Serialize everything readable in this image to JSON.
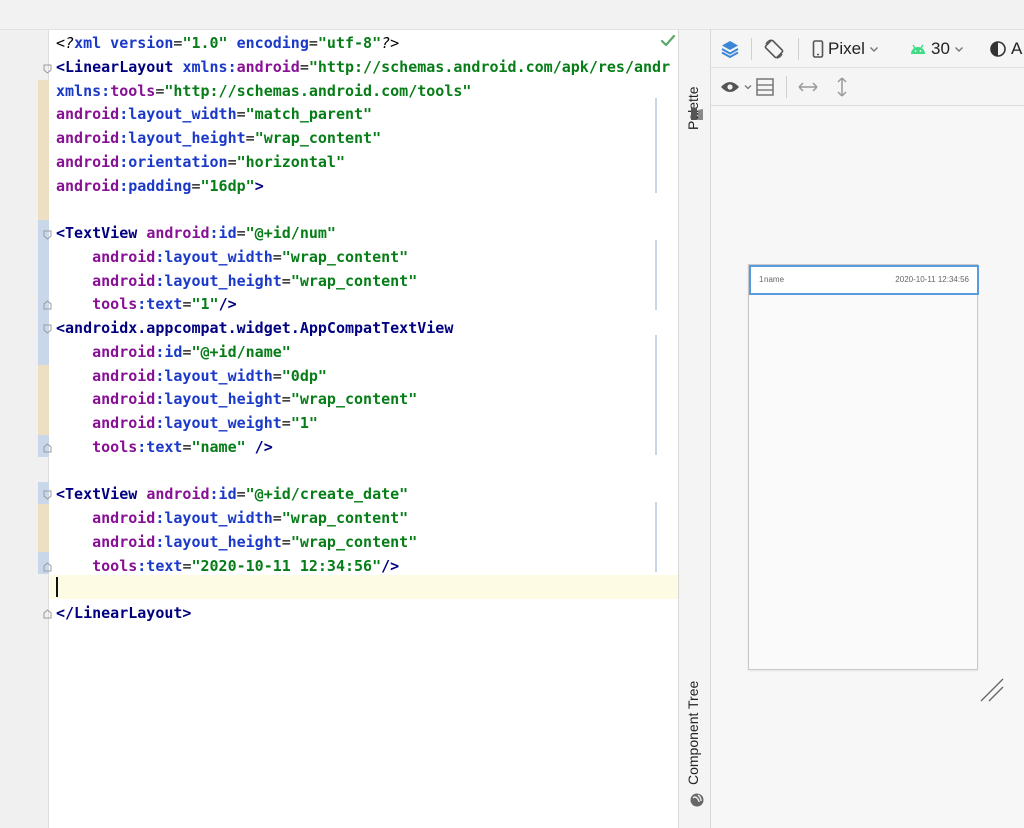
{
  "editor": {
    "lines": [
      [
        [
          "pi",
          "<?"
        ],
        [
          "pa",
          "xml version"
        ],
        [
          "pi",
          "="
        ],
        [
          "str",
          "\"1.0\""
        ],
        [
          "pa",
          " encoding"
        ],
        [
          "pi",
          "="
        ],
        [
          "str",
          "\"utf-8\""
        ],
        [
          "pi",
          "?>"
        ]
      ],
      [
        [
          "tag",
          "<LinearLayout "
        ],
        [
          "ns",
          "xmlns:"
        ],
        [
          "pur",
          "android"
        ],
        [
          "pi",
          "="
        ],
        [
          "str",
          "\"http://schemas.android.com/apk/res/andr"
        ]
      ],
      [
        [
          "ns",
          "xmlns:"
        ],
        [
          "pur",
          "tools"
        ],
        [
          "pi",
          "="
        ],
        [
          "str",
          "\"http://schemas.android.com/tools\""
        ]
      ],
      [
        [
          "pur",
          "android"
        ],
        [
          "ns",
          ":layout_width"
        ],
        [
          "pi",
          "="
        ],
        [
          "str",
          "\"match_parent\""
        ]
      ],
      [
        [
          "pur",
          "android"
        ],
        [
          "ns",
          ":layout_height"
        ],
        [
          "pi",
          "="
        ],
        [
          "str",
          "\"wrap_content\""
        ]
      ],
      [
        [
          "pur",
          "android"
        ],
        [
          "ns",
          ":orientation"
        ],
        [
          "pi",
          "="
        ],
        [
          "str",
          "\"horizontal\""
        ]
      ],
      [
        [
          "pur",
          "android"
        ],
        [
          "ns",
          ":padding"
        ],
        [
          "pi",
          "="
        ],
        [
          "str",
          "\"16dp\""
        ],
        [
          "tag",
          ">"
        ]
      ],
      [],
      [
        [
          "tag",
          "<TextView "
        ],
        [
          "pur",
          "android"
        ],
        [
          "ns",
          ":id"
        ],
        [
          "pi",
          "="
        ],
        [
          "str",
          "\"@+id/num\""
        ]
      ],
      [
        [
          "pi",
          "    "
        ],
        [
          "pur",
          "android"
        ],
        [
          "ns",
          ":layout_width"
        ],
        [
          "pi",
          "="
        ],
        [
          "str",
          "\"wrap_content\""
        ]
      ],
      [
        [
          "pi",
          "    "
        ],
        [
          "pur",
          "android"
        ],
        [
          "ns",
          ":layout_height"
        ],
        [
          "pi",
          "="
        ],
        [
          "str",
          "\"wrap_content\""
        ]
      ],
      [
        [
          "pi",
          "    "
        ],
        [
          "pur",
          "tools"
        ],
        [
          "ns",
          ":text"
        ],
        [
          "pi",
          "="
        ],
        [
          "str",
          "\"1\""
        ],
        [
          "tag",
          "/>"
        ]
      ],
      [
        [
          "tag",
          "<androidx.appcompat.widget.AppCompatTextView"
        ]
      ],
      [
        [
          "pi",
          "    "
        ],
        [
          "pur",
          "android"
        ],
        [
          "ns",
          ":id"
        ],
        [
          "pi",
          "="
        ],
        [
          "str",
          "\"@+id/name\""
        ]
      ],
      [
        [
          "pi",
          "    "
        ],
        [
          "pur",
          "android"
        ],
        [
          "ns",
          ":layout_width"
        ],
        [
          "pi",
          "="
        ],
        [
          "str",
          "\"0dp\""
        ]
      ],
      [
        [
          "pi",
          "    "
        ],
        [
          "pur",
          "android"
        ],
        [
          "ns",
          ":layout_height"
        ],
        [
          "pi",
          "="
        ],
        [
          "str",
          "\"wrap_content\""
        ]
      ],
      [
        [
          "pi",
          "    "
        ],
        [
          "pur",
          "android"
        ],
        [
          "ns",
          ":layout_weight"
        ],
        [
          "pi",
          "="
        ],
        [
          "str",
          "\"1\""
        ]
      ],
      [
        [
          "pi",
          "    "
        ],
        [
          "pur",
          "tools"
        ],
        [
          "ns",
          ":text"
        ],
        [
          "pi",
          "="
        ],
        [
          "str",
          "\"name\""
        ],
        [
          "tag",
          " />"
        ]
      ],
      [],
      [
        [
          "tag",
          "<TextView "
        ],
        [
          "pur",
          "android"
        ],
        [
          "ns",
          ":id"
        ],
        [
          "pi",
          "="
        ],
        [
          "str",
          "\"@+id/create_date\""
        ]
      ],
      [
        [
          "pi",
          "    "
        ],
        [
          "pur",
          "android"
        ],
        [
          "ns",
          ":layout_width"
        ],
        [
          "pi",
          "="
        ],
        [
          "str",
          "\"wrap_content\""
        ]
      ],
      [
        [
          "pi",
          "    "
        ],
        [
          "pur",
          "android"
        ],
        [
          "ns",
          ":layout_height"
        ],
        [
          "pi",
          "="
        ],
        [
          "str",
          "\"wrap_content\""
        ]
      ],
      [
        [
          "pi",
          "    "
        ],
        [
          "pur",
          "tools"
        ],
        [
          "ns",
          ":text"
        ],
        [
          "pi",
          "="
        ],
        [
          "str",
          "\"2020-10-11 12:34:56\""
        ],
        [
          "tag",
          "/>"
        ]
      ],
      [],
      [
        [
          "tag",
          "</LinearLayout>"
        ]
      ]
    ]
  },
  "side_tabs": {
    "palette": "Palette",
    "component_tree": "Component Tree"
  },
  "toolbar": {
    "device": "Pixel",
    "api_level": "30",
    "theme_partial": "A"
  },
  "preview": {
    "num_text": "1",
    "name_text": "name",
    "date_text": "2020-10-11 12:34:56"
  },
  "colors": {
    "accent_selection": "#5a9be0",
    "android_green": "#3ddc84"
  }
}
